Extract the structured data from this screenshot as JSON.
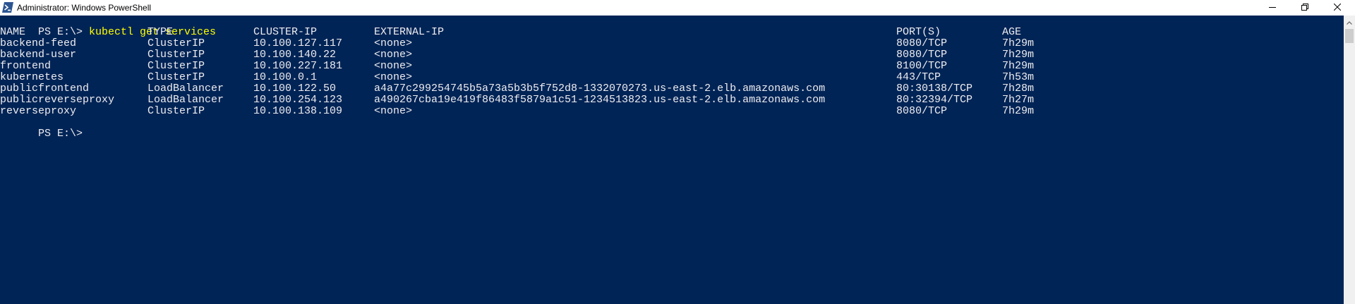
{
  "window": {
    "title": "Administrator: Windows PowerShell",
    "icon": "powershell-icon",
    "buttons": {
      "minimize_icon": "minimize-icon",
      "restore_icon": "restore-icon",
      "close_icon": "close-icon"
    }
  },
  "colors": {
    "console_background": "#012456",
    "console_text": "#eeedf0",
    "command_text": "#ffff00",
    "titlebar_background": "#ffffff"
  },
  "console": {
    "prompt1": "PS E:\\> ",
    "command": "kubectl get services",
    "headers": [
      "NAME",
      "TYPE",
      "CLUSTER-IP",
      "EXTERNAL-IP",
      "PORT(S)",
      "AGE"
    ],
    "rows": [
      [
        "backend-feed",
        "ClusterIP",
        "10.100.127.117",
        "<none>",
        "8080/TCP",
        "7h29m"
      ],
      [
        "backend-user",
        "ClusterIP",
        "10.100.140.22",
        "<none>",
        "8080/TCP",
        "7h29m"
      ],
      [
        "frontend",
        "ClusterIP",
        "10.100.227.181",
        "<none>",
        "8100/TCP",
        "7h29m"
      ],
      [
        "kubernetes",
        "ClusterIP",
        "10.100.0.1",
        "<none>",
        "443/TCP",
        "7h53m"
      ],
      [
        "publicfrontend",
        "LoadBalancer",
        "10.100.122.50",
        "a4a77c299254745b5a73a5b3b5f752d8-1332070273.us-east-2.elb.amazonaws.com",
        "80:30138/TCP",
        "7h28m"
      ],
      [
        "publicreverseproxy",
        "LoadBalancer",
        "10.100.254.123",
        "a490267cba19e419f86483f5879a1c51-1234513823.us-east-2.elb.amazonaws.com",
        "80:32394/TCP",
        "7h27m"
      ],
      [
        "reverseproxy",
        "ClusterIP",
        "10.100.138.109",
        "<none>",
        "8080/TCP",
        "7h29m"
      ]
    ],
    "prompt2": "PS E:\\> "
  }
}
